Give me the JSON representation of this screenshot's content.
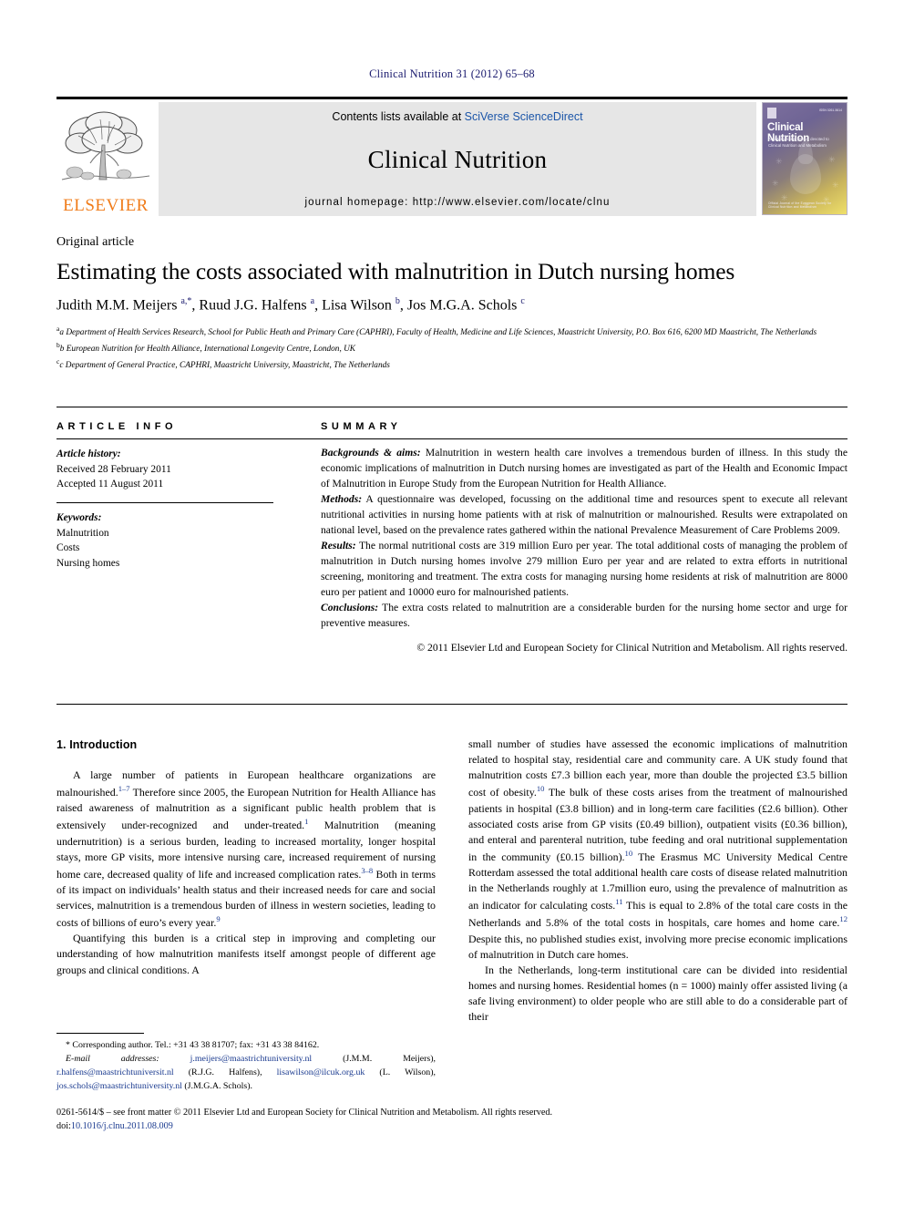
{
  "running_head": "Clinical Nutrition 31 (2012) 65–68",
  "masthead": {
    "publisher_word": "ELSEVIER",
    "contents_prefix": "Contents lists available at ",
    "contents_link": "SciVerse ScienceDirect",
    "journal_name": "Clinical Nutrition",
    "homepage": "journal homepage: http://www.elsevier.com/locate/clnu",
    "cover": {
      "title": "Clinical Nutrition",
      "subtitle": "An international journal devoted to Clinical Nutrition and Metabolism",
      "footer": "Official Journal of the European Society for Clinical Nutrition and Metabolism",
      "issn": "ISSN 0261-5614"
    }
  },
  "article": {
    "type": "Original article",
    "title": "Estimating the costs associated with malnutrition in Dutch nursing homes",
    "authors_html": "Judith M.M. Meijers <sup>a,*</sup>, Ruud J.G. Halfens <sup>a</sup>, Lisa Wilson <sup>b</sup>, Jos M.G.A. Schols <sup>c</sup>",
    "affiliations": [
      "a Department of Health Services Research, School for Public Heath and Primary Care (CAPHRI), Faculty of Health, Medicine and Life Sciences, Maastricht University, P.O. Box 616, 6200 MD Maastricht, The Netherlands",
      "b European Nutrition for Health Alliance, International Longevity Centre, London, UK",
      "c Department of General Practice, CAPHRI, Maastricht University, Maastricht, The Netherlands"
    ]
  },
  "article_info": {
    "heading": "ARTICLE INFO",
    "history_label": "Article history:",
    "received": "Received 28 February 2011",
    "accepted": "Accepted 11 August 2011",
    "keywords_label": "Keywords:",
    "keywords": [
      "Malnutrition",
      "Costs",
      "Nursing homes"
    ]
  },
  "summary": {
    "heading": "SUMMARY",
    "backgrounds_label": "Backgrounds & aims:",
    "backgrounds_text": " Malnutrition in western health care involves a tremendous burden of illness. In this study the economic implications of malnutrition in Dutch nursing homes are investigated as part of the Health and Economic Impact of Malnutrition in Europe Study from the European Nutrition for Health Alliance.",
    "methods_label": "Methods:",
    "methods_text": " A questionnaire was developed, focussing on the additional time and resources spent to execute all relevant nutritional activities in nursing home patients with at risk of malnutrition or malnourished. Results were extrapolated on national level, based on the prevalence rates gathered within the national Prevalence Measurement of Care Problems 2009.",
    "results_label": "Results:",
    "results_text": " The normal nutritional costs are 319 million Euro per year. The total additional costs of managing the problem of malnutrition in Dutch nursing homes involve 279 million Euro per year and are related to extra efforts in nutritional screening, monitoring and treatment. The extra costs for managing nursing home residents at risk of malnutrition are 8000 euro per patient and 10000 euro for malnourished patients.",
    "conclusions_label": "Conclusions:",
    "conclusions_text": " The extra costs related to malnutrition are a considerable burden for the nursing home sector and urge for preventive measures.",
    "copyright": "© 2011 Elsevier Ltd and European Society for Clinical Nutrition and Metabolism. All rights reserved."
  },
  "body": {
    "section_heading": "1. Introduction",
    "left_paragraphs_html": [
      "A large number of patients in European healthcare organizations are malnourished.<sup class=\"ref\">1&#8211;7</sup> Therefore since 2005, the European Nutrition for Health Alliance has raised awareness of malnutrition as a significant public health problem that is extensively under-recognized and under-treated.<sup class=\"ref\">1</sup> Malnutrition (meaning undernutrition) is a serious burden, leading to increased mortality, longer hospital stays, more GP visits, more intensive nursing care, increased requirement of nursing home care, decreased quality of life and increased complication rates.<sup class=\"ref\">3&#8211;8</sup> Both in terms of its impact on individuals&#8217; health status and their increased needs for care and social services, malnutrition is a tremendous burden of illness in western societies, leading to costs of billions of euro&#8217;s every year.<sup class=\"ref\">9</sup>",
      "Quantifying this burden is a critical step in improving and completing our understanding of how malnutrition manifests itself amongst people of different age groups and clinical conditions. A"
    ],
    "right_paragraphs_html": [
      "small number of studies have assessed the economic implications of malnutrition related to hospital stay, residential care and community care. A UK study found that malnutrition costs &#163;7.3 billion each year, more than double the projected &#163;3.5 billion cost of obesity.<sup class=\"ref\">10</sup> The bulk of these costs arises from the treatment of malnourished patients in hospital (&#163;3.8 billion) and in long-term care facilities (&#163;2.6 billion). Other associated costs arise from GP visits (&#163;0.49 billion), outpatient visits (&#163;0.36 billion), and enteral and parenteral nutrition, tube feeding and oral nutritional supplementation in the community (&#163;0.15 billion).<sup class=\"ref\">10</sup> The Erasmus MC University Medical Centre Rotterdam assessed the total additional health care costs of disease related malnutrition in the Netherlands roughly at 1.7million euro, using the prevalence of malnutrition as an indicator for calculating costs.<sup class=\"ref\">11</sup> This is equal to 2.8% of the total care costs in the Netherlands and 5.8% of the total costs in hospitals, care homes and home care.<sup class=\"ref\">12</sup> Despite this, no published studies exist, involving more precise economic implications of malnutrition in Dutch care homes.",
      "In the Netherlands, long-term institutional care can be divided into residential homes and nursing homes. Residential homes (n = 1000) mainly offer assisted living (a safe living environment) to older people who are still able to do a considerable part of their"
    ]
  },
  "footnotes": {
    "corresponding_html": "* Corresponding author. Tel.: +31 43 38 81707; fax: +31 43 38 84162.",
    "email_label": "E-mail addresses:",
    "email_html": " <span class=\"mail\">j.meijers@maastrichtuniversity.nl</span> (J.M.M. Meijers), <span class=\"mail\">r.halfens@maastrichtuniversit.nl</span> (R.J.G. Halfens), <span class=\"mail\">lisawilson@ilcuk.org.uk</span> (L. Wilson), <span class=\"mail\">jos.schols@maastrichtuniversity.nl</span> (J.M.G.A. Schols)."
  },
  "issn_line": {
    "text": "0261-5614/$ – see front matter © 2011 Elsevier Ltd and European Society for Clinical Nutrition and Metabolism. All rights reserved.",
    "doi_prefix": "doi:",
    "doi": "10.1016/j.clnu.2011.08.009"
  }
}
